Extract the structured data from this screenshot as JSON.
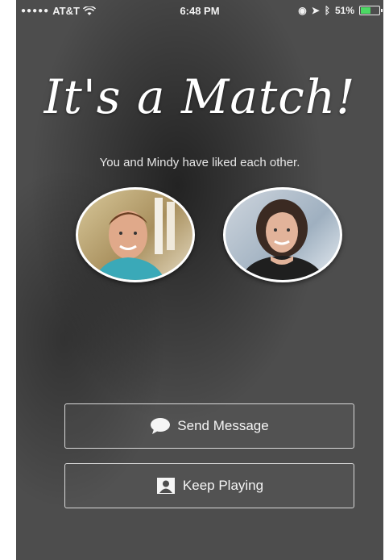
{
  "status_bar": {
    "signal_dots": "●●●●●",
    "carrier": "AT&T",
    "time": "6:48 PM",
    "battery_percent": "51%",
    "battery_level": 0.51
  },
  "match": {
    "title": "It's a Match!",
    "subtitle": "You and Mindy have liked each other."
  },
  "actions": {
    "send_message_label": "Send Message",
    "keep_playing_label": "Keep Playing"
  },
  "colors": {
    "background": "#4d4d4d",
    "battery": "#4cd964",
    "text": "#ffffff"
  }
}
